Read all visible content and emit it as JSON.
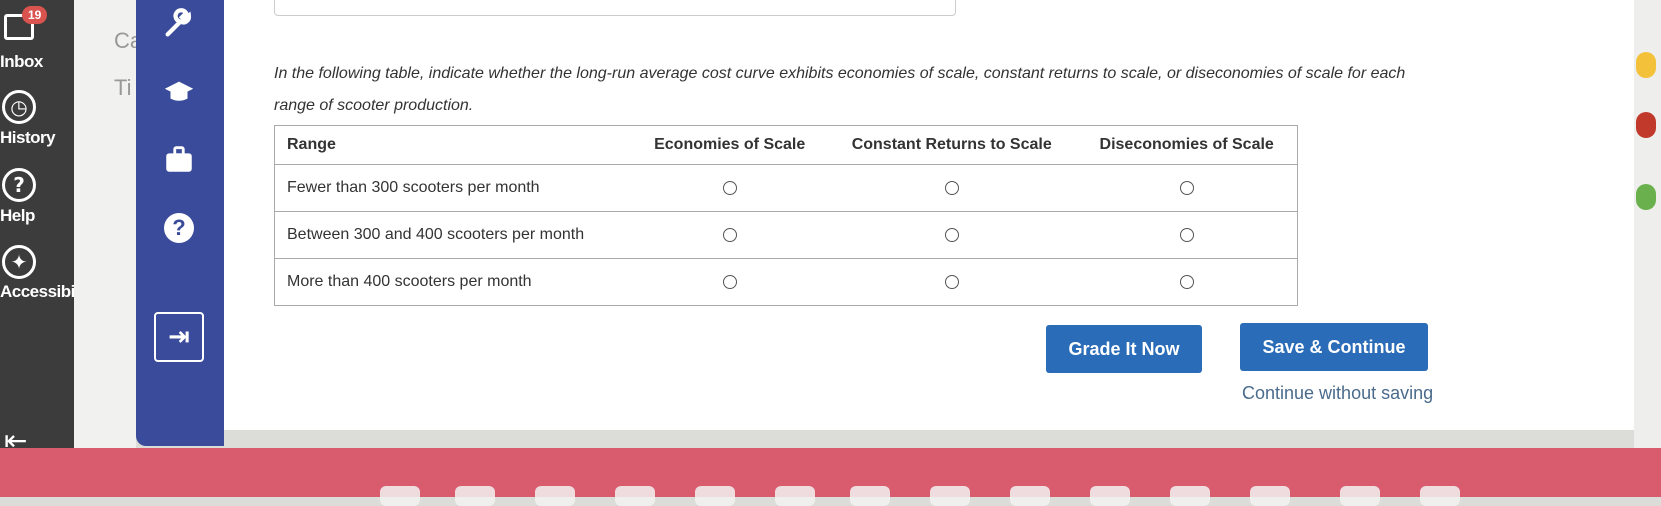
{
  "left_sidebar": {
    "inbox_badge": "19",
    "items": [
      {
        "label": "Inbox",
        "icon": "inbox-icon"
      },
      {
        "label": "History",
        "icon": "clock-icon"
      },
      {
        "label": "Help",
        "icon": "question-icon"
      },
      {
        "label": "Accessibility",
        "icon": "accessibility-icon"
      }
    ],
    "collapse_icon": "collapse-left-icon"
  },
  "strip": {
    "text1": "Ca",
    "text2": "Ti"
  },
  "tool_sidebar": {
    "icons": [
      "wrench-icon",
      "graduation-cap-icon",
      "briefcase-icon",
      "help-icon",
      "exit-icon"
    ]
  },
  "question": {
    "prompt": "In the following table, indicate whether the long-run average cost curve exhibits economies of scale, constant returns to scale, or diseconomies of scale for each range of scooter production.",
    "columns": [
      "Range",
      "Economies of Scale",
      "Constant Returns to Scale",
      "Diseconomies of Scale"
    ],
    "rows": [
      "Fewer than 300 scooters per month",
      "Between 300 and 400 scooters per month",
      "More than 400 scooters per month"
    ]
  },
  "actions": {
    "grade_label": "Grade It Now",
    "save_label": "Save & Continue",
    "continue_label": "Continue without saving"
  },
  "colors": {
    "sidebar_dark": "#3c3c3c",
    "toolbar_blue": "#3b4b9c",
    "button_blue": "#2b6cb8",
    "dock": "#d95c6e"
  }
}
